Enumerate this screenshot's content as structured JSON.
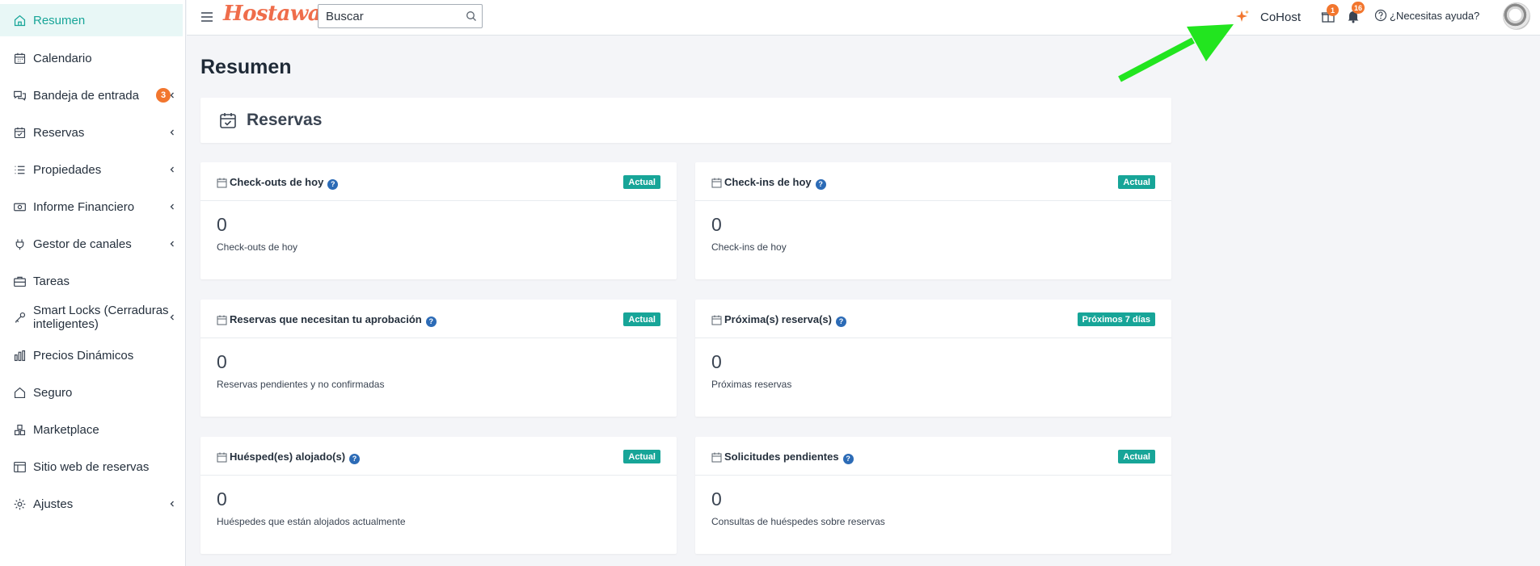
{
  "sidebar": {
    "items": [
      {
        "label": "Resumen",
        "icon": "home-icon",
        "active": true
      },
      {
        "label": "Calendario",
        "icon": "calendar-grid-icon"
      },
      {
        "label": "Bandeja de entrada",
        "icon": "chat-bubbles-icon",
        "badge": "3",
        "has_submenu": true
      },
      {
        "label": "Reservas",
        "icon": "calendar-check-icon",
        "has_submenu": true
      },
      {
        "label": "Propiedades",
        "icon": "list-icon",
        "has_submenu": true
      },
      {
        "label": "Informe Financiero",
        "icon": "money-icon",
        "has_submenu": true
      },
      {
        "label": "Gestor de canales",
        "icon": "plug-icon",
        "has_submenu": true
      },
      {
        "label": "Tareas",
        "icon": "briefcase-icon"
      },
      {
        "label": "Smart Locks (Cerraduras inteligentes)",
        "icon": "key-icon",
        "has_submenu": true
      },
      {
        "label": "Precios Dinámicos",
        "icon": "bar-chart-icon"
      },
      {
        "label": "Seguro",
        "icon": "house-shield-icon"
      },
      {
        "label": "Marketplace",
        "icon": "boxes-icon"
      },
      {
        "label": "Sitio web de reservas",
        "icon": "website-icon"
      },
      {
        "label": "Ajustes",
        "icon": "gear-icon",
        "has_submenu": true
      }
    ]
  },
  "topbar": {
    "logo": "Hostaway",
    "search_placeholder": "Buscar",
    "cohost_label": "CoHost",
    "gift_badge": "1",
    "notifications_badge": "16",
    "help_label": "¿Necesitas ayuda?"
  },
  "main": {
    "page_title": "Resumen",
    "section_title": "Reservas",
    "cards": [
      {
        "title": "Check-outs de hoy",
        "tag": "Actual",
        "value": "0",
        "subtitle": "Check-outs de hoy"
      },
      {
        "title": "Check-ins de hoy",
        "tag": "Actual",
        "value": "0",
        "subtitle": "Check-ins de hoy"
      },
      {
        "title": "Reservas que necesitan tu aprobación",
        "tag": "Actual",
        "value": "0",
        "subtitle": "Reservas pendientes y no confirmadas"
      },
      {
        "title": "Próxima(s) reserva(s)",
        "tag": "Próximos 7 días",
        "value": "0",
        "subtitle": "Próximas reservas"
      },
      {
        "title": "Huésped(es) alojado(s)",
        "tag": "Actual",
        "value": "0",
        "subtitle": "Huéspedes que están alojados actualmente"
      },
      {
        "title": "Solicitudes pendientes",
        "tag": "Actual",
        "value": "0",
        "subtitle": "Consultas de huéspedes sobre reservas"
      }
    ]
  },
  "colors": {
    "accent": "#17a598",
    "badge": "#f2762e",
    "logo": "#ef6d4b",
    "help_icon": "#2c6bb6",
    "annotation_arrow": "#22e51f"
  }
}
